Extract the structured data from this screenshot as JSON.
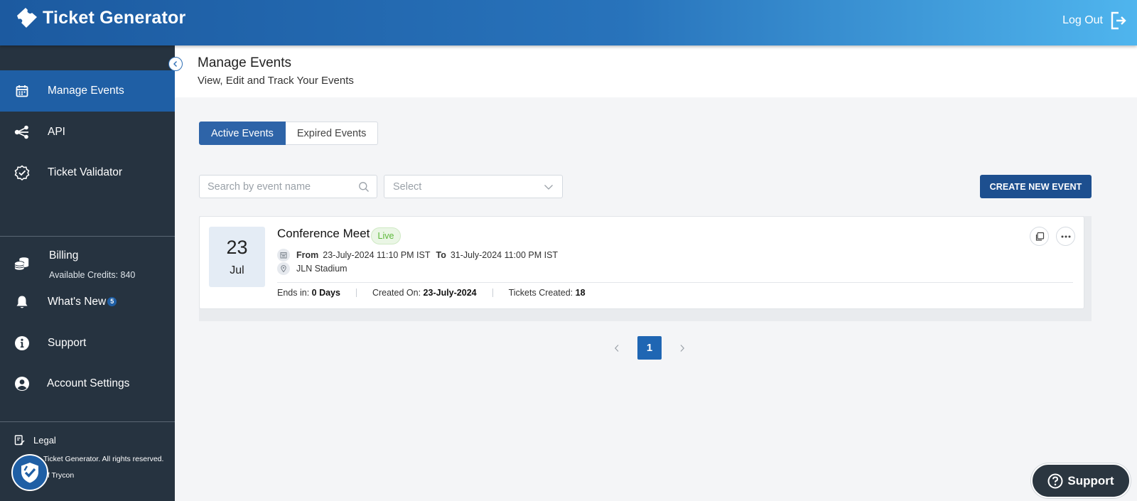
{
  "header": {
    "brand": "Ticket Generator",
    "logout_label": "Log Out"
  },
  "sidebar": {
    "items": [
      {
        "label": "Manage Events",
        "icon": "calendar-icon",
        "active": true
      },
      {
        "label": "API",
        "icon": "share-nodes-icon"
      },
      {
        "label": "Ticket Validator",
        "icon": "badge-check-icon"
      }
    ],
    "billing": {
      "label": "Billing",
      "sub": "Available Credits: 840",
      "icon": "coins-icon"
    },
    "whats_new": {
      "label": "What's New",
      "badge": "5",
      "icon": "bell-icon"
    },
    "support": {
      "label": "Support",
      "icon": "info-icon"
    },
    "account": {
      "label": "Account Settings",
      "icon": "user-circle-icon"
    },
    "legal": {
      "label": "Legal",
      "icon": "document-edit-icon"
    },
    "copyright_line1": "Ticket Generator. All rights reserved.",
    "copyright_line2": "of Trycon"
  },
  "main": {
    "title": "Manage Events",
    "subtitle": "View, Edit and Track Your Events",
    "tabs": [
      {
        "label": "Active Events",
        "active": true
      },
      {
        "label": "Expired Events",
        "active": false
      }
    ],
    "search_placeholder": "Search by event name",
    "select_label": "Select",
    "create_button": "CREATE NEW EVENT",
    "events": [
      {
        "day": "23",
        "month": "Jul",
        "name": "Conference Meet",
        "status": "Live",
        "from_label": "From",
        "from": "23-July-2024 11:10 PM IST",
        "to_label": "To",
        "to": "31-July-2024 11:00 PM IST",
        "venue": "JLN Stadium",
        "ends_label": "Ends in:",
        "ends": "0 Days",
        "created_label": "Created On:",
        "created": "23-July-2024",
        "tickets_label": "Tickets Created:",
        "tickets": "18"
      }
    ],
    "pagination": {
      "current": "1"
    }
  },
  "support_fab": {
    "label": "Support"
  },
  "colors": {
    "header_start": "#1c5aa0",
    "header_end": "#4fb5ee",
    "sidebar_bg": "#263340",
    "active_nav": "#1f5fa5",
    "primary_button": "#1d4f8f",
    "live_green": "#5cb83a"
  }
}
